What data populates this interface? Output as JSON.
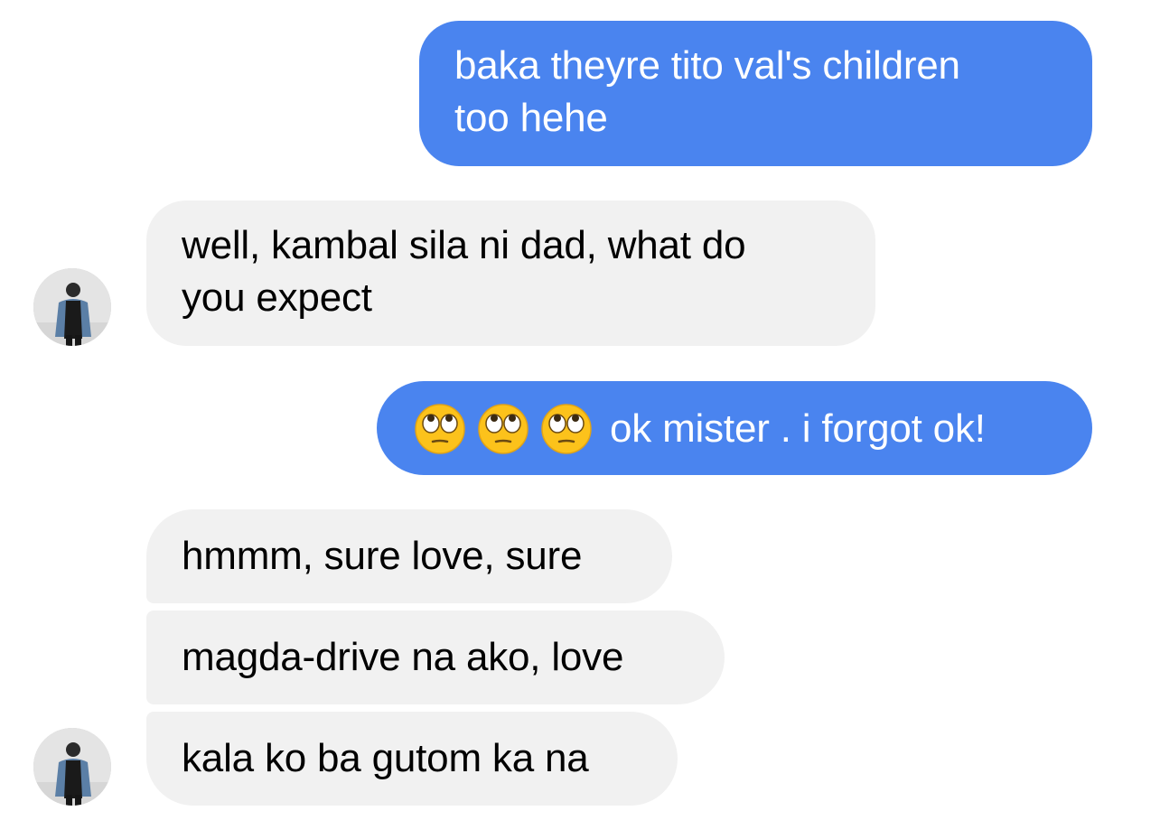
{
  "conversation": {
    "messages": [
      {
        "direction": "outgoing",
        "lines": [
          "baka theyre tito val's children",
          "too hehe"
        ]
      },
      {
        "direction": "incoming",
        "lines": [
          "well, kambal sila ni dad, what do",
          "you expect"
        ]
      },
      {
        "direction": "outgoing",
        "emoji": [
          "face-with-rolling-eyes",
          "face-with-rolling-eyes",
          "face-with-rolling-eyes"
        ],
        "text": "ok mister . i forgot ok!"
      },
      {
        "direction": "incoming",
        "text": "hmmm, sure love, sure"
      },
      {
        "direction": "incoming",
        "text": "magda-drive na ako, love"
      },
      {
        "direction": "incoming",
        "text": "kala ko ba gutom ka na"
      }
    ]
  },
  "colors": {
    "outgoing_bubble": "#4a84ef",
    "incoming_bubble": "#f1f1f1",
    "outgoing_text": "#ffffff",
    "incoming_text": "#000000"
  }
}
